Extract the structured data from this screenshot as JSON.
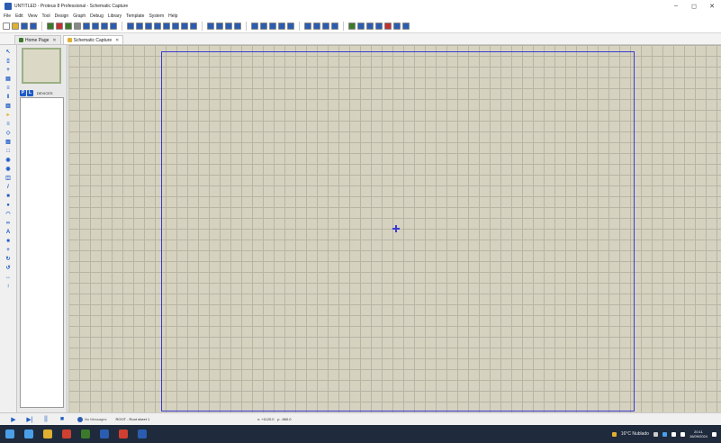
{
  "window": {
    "title": "UNTITLED - Proteus 8 Professional - Schematic Capture",
    "controls": {
      "minimize": "–",
      "maximize": "◻",
      "close": "✕"
    }
  },
  "menu": [
    "File",
    "Edit",
    "View",
    "Tool",
    "Design",
    "Graph",
    "Debug",
    "Library",
    "Template",
    "System",
    "Help"
  ],
  "toolbar": {
    "icons": [
      {
        "name": "new-icon",
        "color": "#ffffff"
      },
      {
        "name": "open-icon",
        "color": "#e0b030"
      },
      {
        "name": "save-icon",
        "color": "#2a5db0"
      },
      {
        "name": "close-project-icon",
        "color": "#2a5db0"
      },
      {
        "name": "home-icon",
        "color": "#3b7a2b"
      },
      {
        "name": "schematic-icon",
        "color": "#c03030"
      },
      {
        "name": "pcb-icon",
        "color": "#3b7a2b"
      },
      {
        "name": "gerber-icon",
        "color": "#888888"
      },
      {
        "name": "3d-icon",
        "color": "#2a5db0"
      },
      {
        "name": "bom-icon",
        "color": "#2a5db0"
      },
      {
        "name": "design-explorer-icon",
        "color": "#2a5db0"
      },
      {
        "name": "help-icon",
        "color": "#2a5db0"
      },
      {
        "name": "refresh-icon",
        "color": "#2a5db0"
      },
      {
        "name": "grid-icon",
        "color": "#2a5db0"
      },
      {
        "name": "origin-icon",
        "color": "#2a5db0"
      },
      {
        "name": "pan-icon",
        "color": "#2a5db0"
      },
      {
        "name": "zoom-in-icon",
        "color": "#2a5db0"
      },
      {
        "name": "zoom-out-icon",
        "color": "#2a5db0"
      },
      {
        "name": "zoom-all-icon",
        "color": "#2a5db0"
      },
      {
        "name": "zoom-area-icon",
        "color": "#2a5db0"
      },
      {
        "name": "undo-icon",
        "color": "#2a5db0"
      },
      {
        "name": "redo-icon",
        "color": "#2a5db0"
      },
      {
        "name": "cut-icon",
        "color": "#2a5db0"
      },
      {
        "name": "copy-icon",
        "color": "#2a5db0"
      },
      {
        "name": "paste-icon",
        "color": "#2a5db0"
      },
      {
        "name": "block-copy-icon",
        "color": "#2a5db0"
      },
      {
        "name": "block-move-icon",
        "color": "#2a5db0"
      },
      {
        "name": "block-rotate-icon",
        "color": "#2a5db0"
      },
      {
        "name": "block-delete-icon",
        "color": "#2a5db0"
      },
      {
        "name": "pick-device-icon",
        "color": "#2a5db0"
      },
      {
        "name": "make-device-icon",
        "color": "#2a5db0"
      },
      {
        "name": "package-tool-icon",
        "color": "#2a5db0"
      },
      {
        "name": "decompose-icon",
        "color": "#2a5db0"
      },
      {
        "name": "wire-autorouter-icon",
        "color": "#3b7a2b"
      },
      {
        "name": "search-tag-icon",
        "color": "#2a5db0"
      },
      {
        "name": "property-assignment-icon",
        "color": "#2a5db0"
      },
      {
        "name": "new-sheet-icon",
        "color": "#2a5db0"
      },
      {
        "name": "remove-sheet-icon",
        "color": "#c03030"
      },
      {
        "name": "exit-to-parent-icon",
        "color": "#2a5db0"
      },
      {
        "name": "netlist-icon",
        "color": "#2a5db0"
      }
    ]
  },
  "tabs": [
    {
      "label": "Home Page",
      "icon": "home-tab-icon",
      "color": "#3b7a2b",
      "active": false
    },
    {
      "label": "Schematic Capture",
      "icon": "schematic-tab-icon",
      "color": "#e0b030",
      "active": true
    }
  ],
  "left_tools": [
    {
      "name": "selection-mode-icon",
      "glyph": "↖",
      "color": "#1e5bc6"
    },
    {
      "name": "component-mode-icon",
      "glyph": "▯",
      "color": "#1e5bc6"
    },
    {
      "name": "junction-dot-icon",
      "glyph": "+",
      "color": "#1e5bc6"
    },
    {
      "name": "wire-label-icon",
      "glyph": "▤",
      "color": "#1e5bc6"
    },
    {
      "name": "text-script-icon",
      "glyph": "≡",
      "color": "#1e5bc6"
    },
    {
      "name": "buses-icon",
      "glyph": "‖",
      "color": "#1e5bc6"
    },
    {
      "name": "subcircuit-icon",
      "glyph": "▥",
      "color": "#1e5bc6"
    },
    {
      "name": "terminals-icon",
      "glyph": "▸",
      "color": "#e0b030"
    },
    {
      "name": "device-pins-icon",
      "glyph": "≡",
      "color": "#1e5bc6"
    },
    {
      "name": "graph-icon",
      "glyph": "◇",
      "color": "#1e5bc6"
    },
    {
      "name": "tape-recorder-icon",
      "glyph": "▨",
      "color": "#1e5bc6"
    },
    {
      "name": "generator-icon",
      "glyph": "□",
      "color": "#1e5bc6"
    },
    {
      "name": "voltage-probe-icon",
      "glyph": "◉",
      "color": "#1e5bc6"
    },
    {
      "name": "current-probe-icon",
      "glyph": "◉",
      "color": "#1e5bc6"
    },
    {
      "name": "virtual-instruments-icon",
      "glyph": "◫",
      "color": "#1e5bc6"
    },
    {
      "name": "line-icon",
      "glyph": "/",
      "color": "#1e5bc6"
    },
    {
      "name": "box-icon",
      "glyph": "■",
      "color": "#1e5bc6"
    },
    {
      "name": "circle-icon",
      "glyph": "●",
      "color": "#1e5bc6"
    },
    {
      "name": "arc-icon",
      "glyph": "◠",
      "color": "#1e5bc6"
    },
    {
      "name": "path-icon",
      "glyph": "∞",
      "color": "#1e5bc6"
    },
    {
      "name": "text-icon",
      "glyph": "A",
      "color": "#1e5bc6"
    },
    {
      "name": "symbol-icon",
      "glyph": "■",
      "color": "#1e5bc6"
    },
    {
      "name": "marker-icon",
      "glyph": "+",
      "color": "#1e5bc6"
    },
    {
      "name": "rotate-cw-icon",
      "glyph": "↻",
      "color": "#1e5bc6"
    },
    {
      "name": "rotate-ccw-icon",
      "glyph": "↺",
      "color": "#1e5bc6"
    },
    {
      "name": "mirror-x-icon",
      "glyph": "↔",
      "color": "#1e5bc6"
    },
    {
      "name": "mirror-y-icon",
      "glyph": "↕",
      "color": "#1e5bc6"
    }
  ],
  "side_panel": {
    "p_button": "P",
    "l_button": "L",
    "devices_label": "DEVICES"
  },
  "canvas": {
    "background": "#d6d2c0",
    "grid_color": "#b9b5a5",
    "sheet_border_color": "#3b3bd2"
  },
  "statusbar": {
    "controls": [
      {
        "name": "play-icon",
        "glyph": "▶"
      },
      {
        "name": "step-icon",
        "glyph": "▶|"
      },
      {
        "name": "pause-icon",
        "glyph": "||"
      },
      {
        "name": "stop-icon",
        "glyph": "■"
      }
    ],
    "messages": "No Messages",
    "sheet": "ROOT - Root sheet 1",
    "coord_x_label": "x:",
    "coord_x": "+1120.0",
    "coord_y_label": "y:",
    "coord_y": "-960.0"
  },
  "taskbar": {
    "icons": [
      {
        "name": "windows-start-icon",
        "color": "#4aa0e8"
      },
      {
        "name": "task-view-icon",
        "color": "#4aa0e8"
      },
      {
        "name": "file-explorer-icon",
        "color": "#e0b030"
      },
      {
        "name": "chrome-icon",
        "color": "#d04030"
      },
      {
        "name": "meet-icon",
        "color": "#3b7a2b"
      },
      {
        "name": "proteus-icon",
        "color": "#2a5db0"
      },
      {
        "name": "app-red-icon",
        "color": "#d04030"
      },
      {
        "name": "word-icon",
        "color": "#2a5db0"
      }
    ],
    "weather": "16°C Nublado",
    "time": "20:11",
    "date": "16/09/2024"
  }
}
